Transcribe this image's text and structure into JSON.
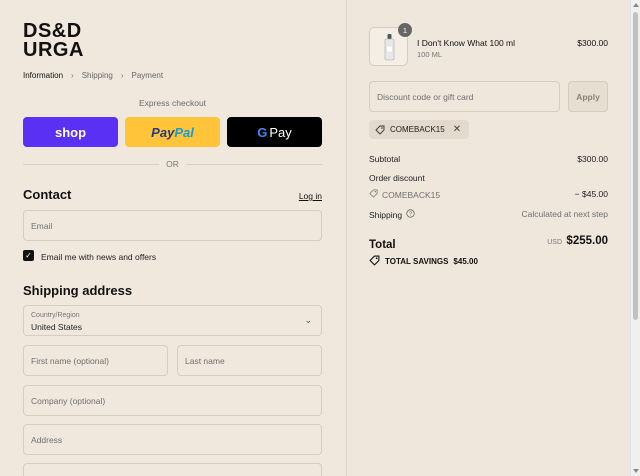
{
  "brand": {
    "logo_line1": "DS&D",
    "logo_line2": "URGA"
  },
  "breadcrumb": {
    "items": [
      "Information",
      "Shipping",
      "Payment"
    ]
  },
  "express": {
    "label": "Express checkout",
    "shop_label": "shop",
    "paypal_label1": "Pay",
    "paypal_label2": "Pal",
    "gpay_g": "G",
    "gpay_label": "Pay"
  },
  "divider_or": "OR",
  "contact": {
    "title": "Contact",
    "login_link": "Log in",
    "email_placeholder": "Email",
    "newsletter_label": "Email me with news and offers"
  },
  "shipping": {
    "title": "Shipping address",
    "country_label": "Country/Region",
    "country_value": "United States",
    "first_name_placeholder": "First name (optional)",
    "last_name_placeholder": "Last name",
    "company_placeholder": "Company (optional)",
    "address_placeholder": "Address"
  },
  "cart": {
    "item": {
      "name": "I Don't Know What 100 ml",
      "variant": "100 ML",
      "price": "$300.00",
      "quantity": "1"
    },
    "discount_placeholder": "Discount code or gift card",
    "apply_label": "Apply",
    "applied_code": "COMEBACK15"
  },
  "summary": {
    "subtotal_label": "Subtotal",
    "subtotal_value": "$300.00",
    "order_discount_label": "Order discount",
    "discount_code": "COMEBACK15",
    "discount_value": "− $45.00",
    "shipping_label": "Shipping",
    "shipping_value": "Calculated at next step",
    "total_label": "Total",
    "currency": "USD",
    "total_value": "$255.00",
    "savings_label": "TOTAL SAVINGS",
    "savings_value": "$45.00"
  }
}
